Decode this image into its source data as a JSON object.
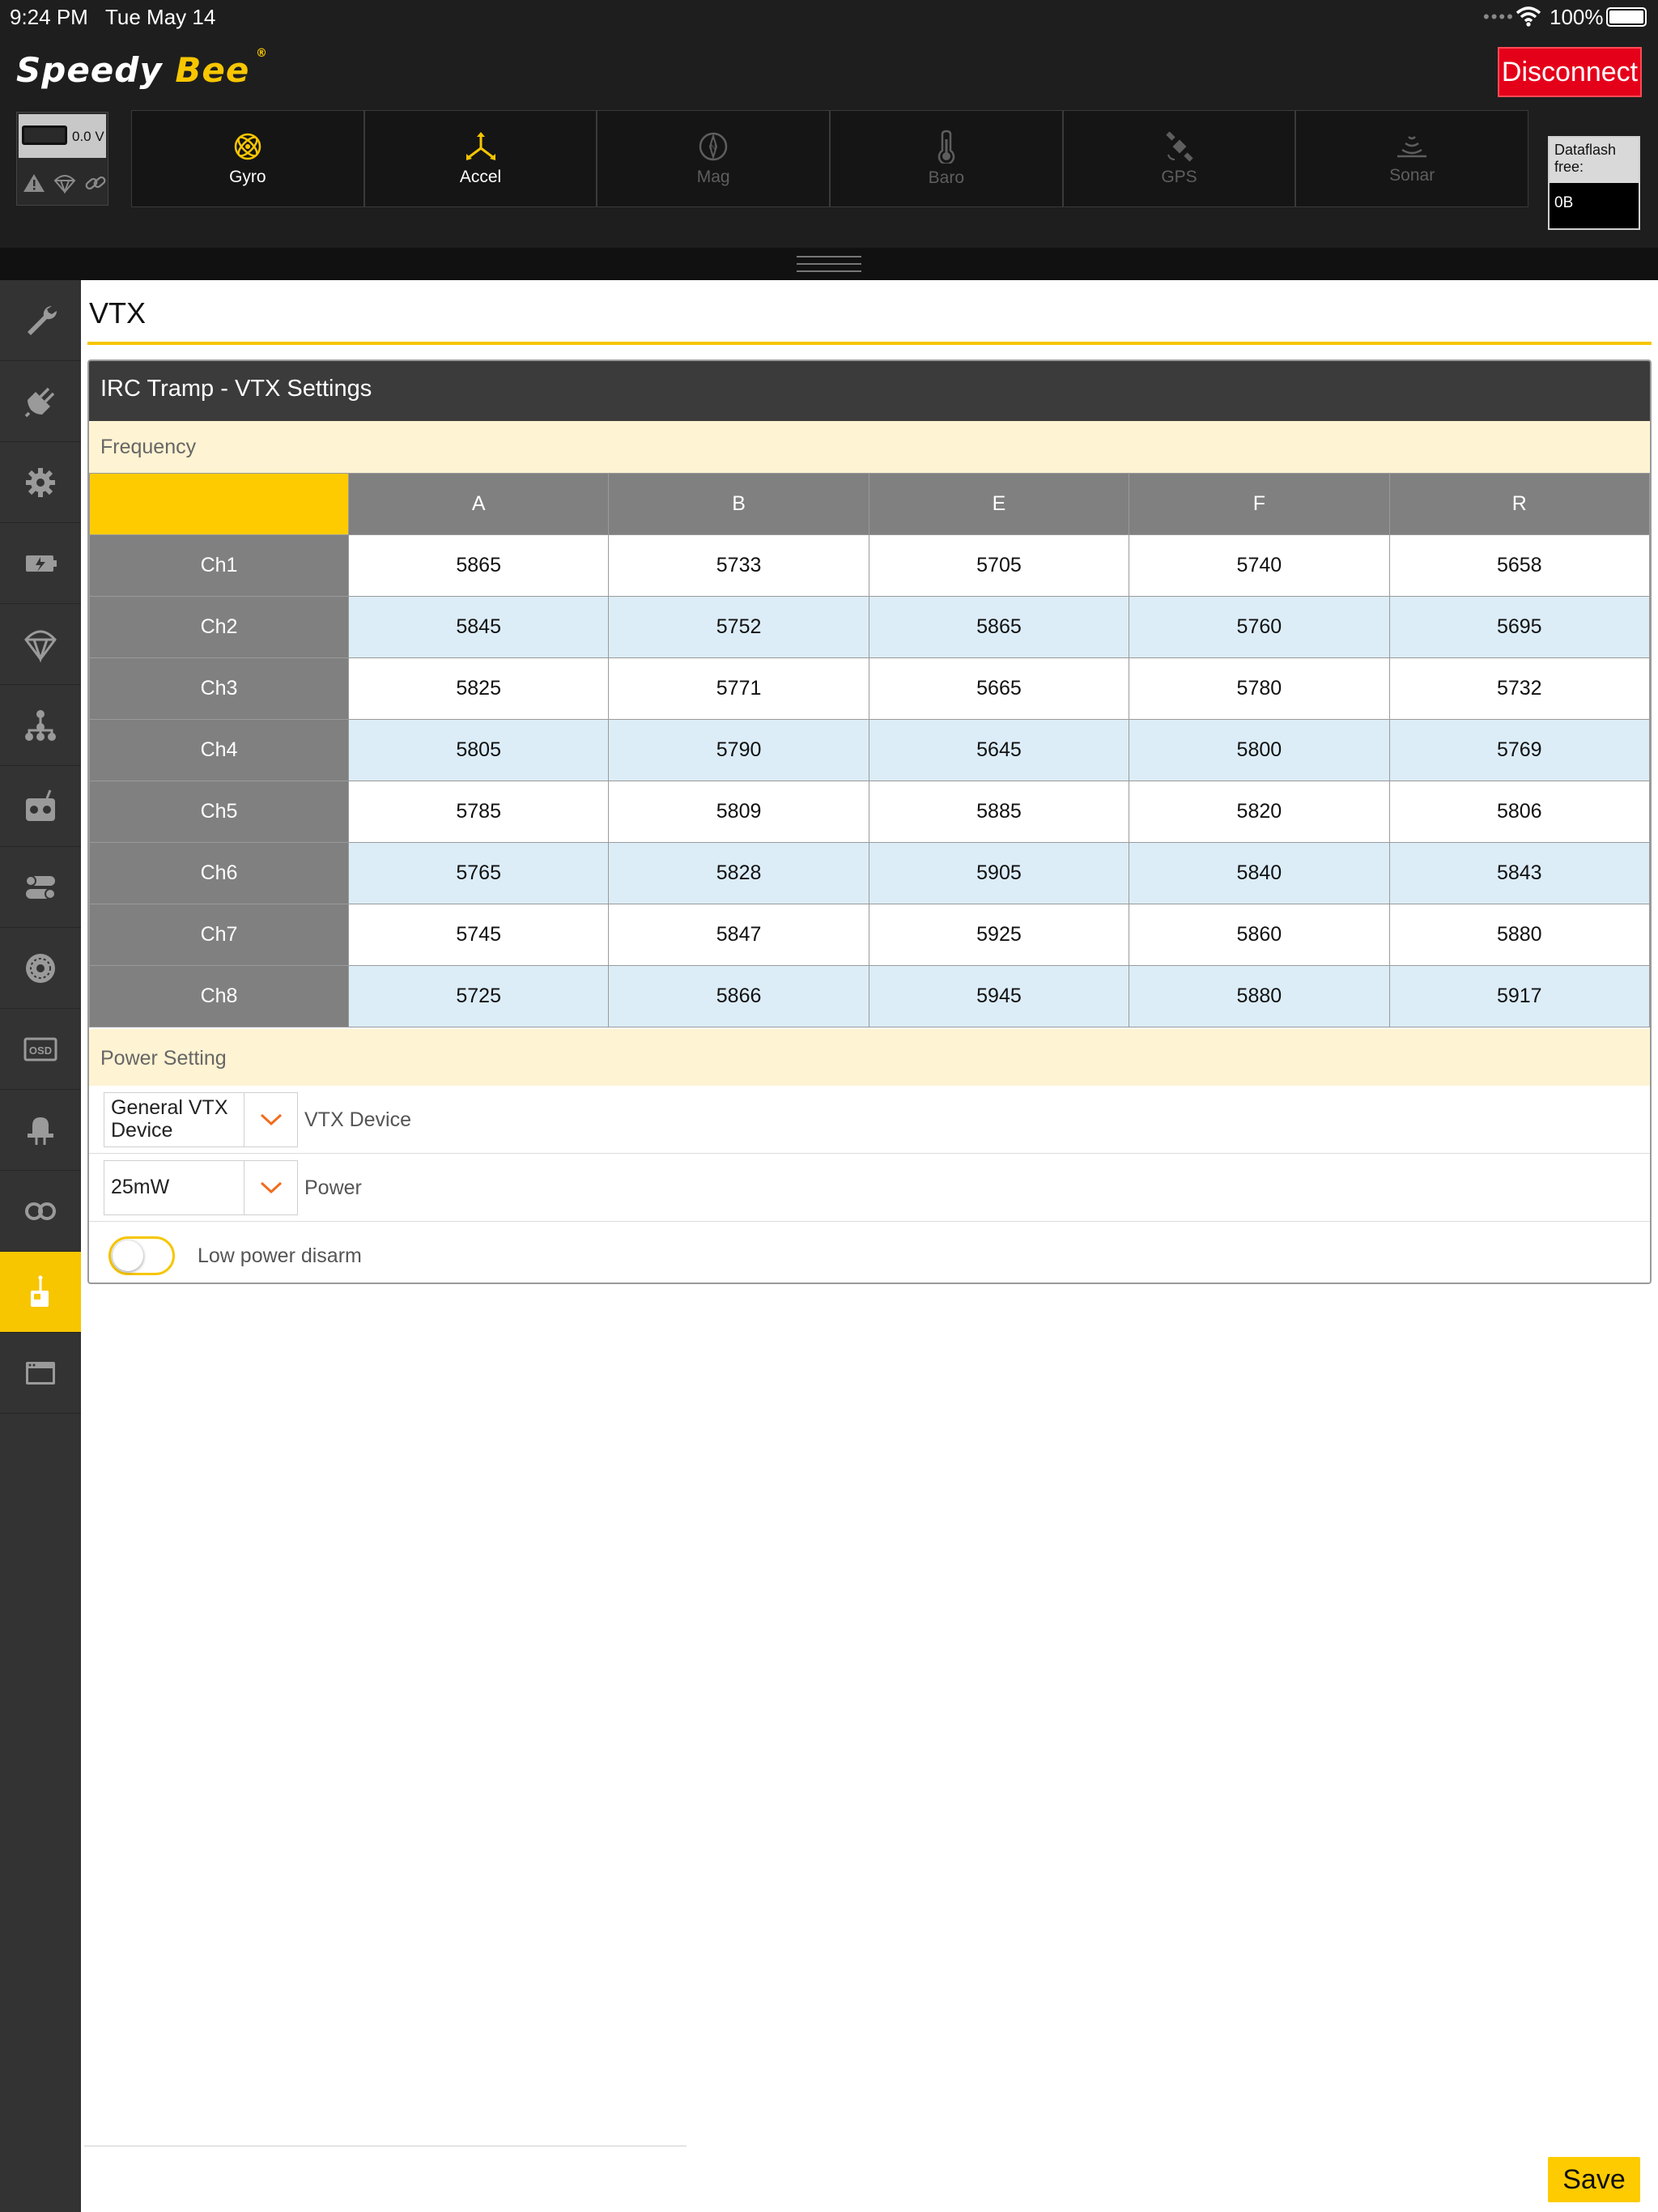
{
  "status_bar": {
    "time": "9:24 PM",
    "date": "Tue May 14",
    "battery": "100%"
  },
  "header": {
    "logo_speedy": "Speedy",
    "logo_bee": "Bee",
    "logo_reg": "®",
    "disconnect_label": "Disconnect",
    "voltage": "0.0 V",
    "dataflash_label": "Dataflash free:",
    "dataflash_value": "0B",
    "sensors": [
      {
        "label": "Gyro",
        "active": true,
        "icon": "gyro-icon"
      },
      {
        "label": "Accel",
        "active": true,
        "icon": "accel-icon"
      },
      {
        "label": "Mag",
        "active": false,
        "icon": "mag-icon"
      },
      {
        "label": "Baro",
        "active": false,
        "icon": "baro-icon"
      },
      {
        "label": "GPS",
        "active": false,
        "icon": "gps-icon"
      },
      {
        "label": "Sonar",
        "active": false,
        "icon": "sonar-icon"
      }
    ]
  },
  "sidebar": {
    "items": [
      {
        "icon": "wrench-icon",
        "active": false
      },
      {
        "icon": "plug-icon",
        "active": false
      },
      {
        "icon": "gear-icon",
        "active": false
      },
      {
        "icon": "battery-power-icon",
        "active": false
      },
      {
        "icon": "parachute-icon",
        "active": false
      },
      {
        "icon": "tree-icon",
        "active": false
      },
      {
        "icon": "receiver-icon",
        "active": false
      },
      {
        "icon": "modes-icon",
        "active": false
      },
      {
        "icon": "motor-icon",
        "active": false
      },
      {
        "icon": "osd-icon",
        "active": false
      },
      {
        "icon": "led-icon",
        "active": false
      },
      {
        "icon": "blackbox-icon",
        "active": false
      },
      {
        "icon": "vtx-icon",
        "active": true
      },
      {
        "icon": "cli-icon",
        "active": false
      }
    ]
  },
  "page": {
    "title": "VTX",
    "card_title": "IRC Tramp - VTX Settings",
    "frequency_label": "Frequency",
    "bands": [
      "A",
      "B",
      "E",
      "F",
      "R"
    ],
    "channels": [
      {
        "name": "Ch1",
        "values": [
          "5865",
          "5733",
          "5705",
          "5740",
          "5658"
        ]
      },
      {
        "name": "Ch2",
        "values": [
          "5845",
          "5752",
          "5865",
          "5760",
          "5695"
        ]
      },
      {
        "name": "Ch3",
        "values": [
          "5825",
          "5771",
          "5665",
          "5780",
          "5732"
        ]
      },
      {
        "name": "Ch4",
        "values": [
          "5805",
          "5790",
          "5645",
          "5800",
          "5769"
        ]
      },
      {
        "name": "Ch5",
        "values": [
          "5785",
          "5809",
          "5885",
          "5820",
          "5806"
        ]
      },
      {
        "name": "Ch6",
        "values": [
          "5765",
          "5828",
          "5905",
          "5840",
          "5843"
        ]
      },
      {
        "name": "Ch7",
        "values": [
          "5745",
          "5847",
          "5925",
          "5860",
          "5880"
        ]
      },
      {
        "name": "Ch8",
        "values": [
          "5725",
          "5866",
          "5945",
          "5880",
          "5917"
        ]
      }
    ],
    "power_setting_label": "Power Setting",
    "vtx_device_value": "General VTX Device",
    "vtx_device_label": "VTX Device",
    "power_value": "25mW",
    "power_label": "Power",
    "low_power_disarm_label": "Low power disarm",
    "low_power_disarm_on": false,
    "save_label": "Save"
  },
  "colors": {
    "accent": "#f7c600",
    "disconnect": "#e5001a",
    "row_alt": "#dcedf8",
    "band": "#fef3d2"
  }
}
